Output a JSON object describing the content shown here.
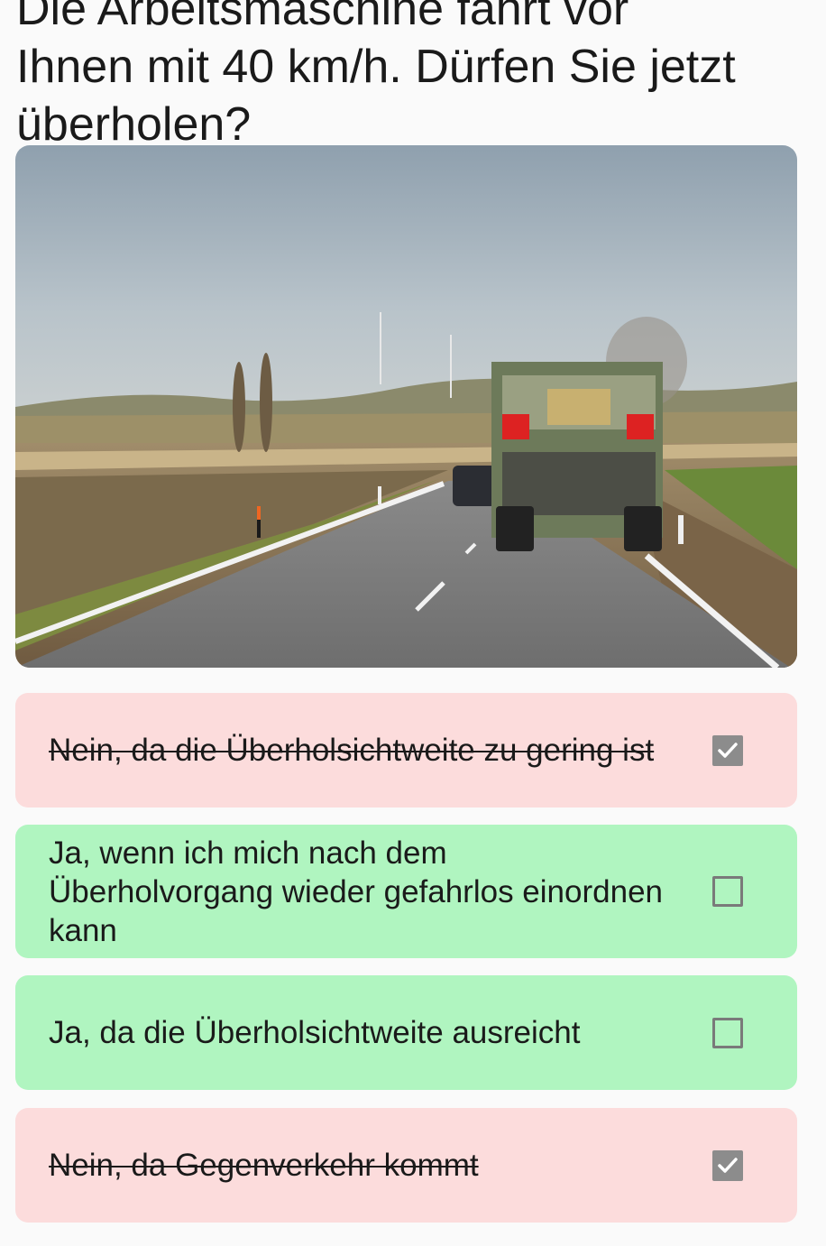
{
  "question": {
    "line_top": "Die Arbeitsmaschine fährt vor",
    "line1": "Ihnen mit 40 km/h. Dürfen Sie jetzt",
    "line2": "überholen?"
  },
  "answers": [
    {
      "text": "Nein, da die Überholsichtweite zu gering ist",
      "checked": true,
      "state": "wrong"
    },
    {
      "text": "Ja, wenn ich mich nach dem Überholvorgang wieder gefahrlos einordnen kann",
      "checked": false,
      "state": "right"
    },
    {
      "text": "Ja, da die Überholsichtweite ausreicht",
      "checked": false,
      "state": "right"
    },
    {
      "text": "Nein, da Gegenverkehr kommt",
      "checked": true,
      "state": "wrong"
    }
  ],
  "colors": {
    "wrong_bg": "#fcdcdc",
    "right_bg": "#b0f5c0",
    "checkbox_checked": "#8c8c8c"
  },
  "icons": {
    "checkmark": "checkmark-icon"
  }
}
